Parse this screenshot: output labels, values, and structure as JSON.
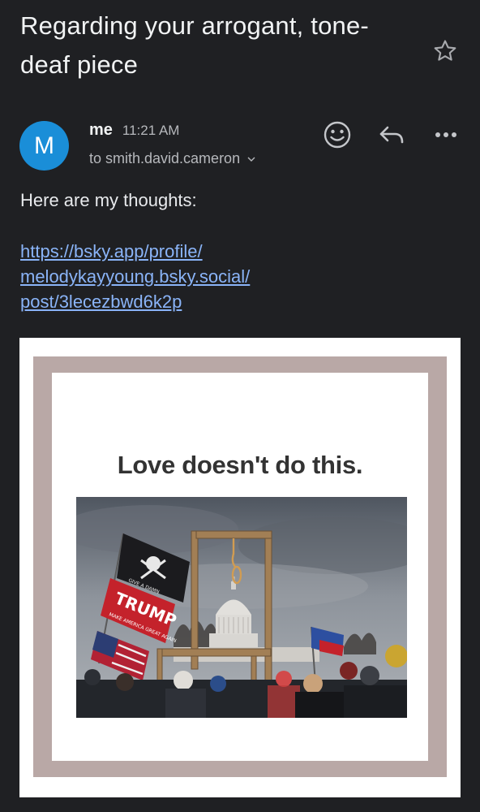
{
  "email": {
    "subject": "Regarding your arrogant, tone-deaf piece",
    "sender": {
      "avatar_letter": "M",
      "name": "me",
      "time": "11:21 AM",
      "recipient": "to smith.david.cameron"
    },
    "body": {
      "intro": "Here are my thoughts:",
      "link_lines": [
        "https://bsky.app/profile/",
        "melodykayyoung.bsky.social/",
        "post/3lecezbwd6k2p"
      ]
    },
    "attachment": {
      "headline": "Love doesn't do this.",
      "flag_pirate_text": "GIVE A DAMN",
      "flag_trump": "TRUMP",
      "flag_trump_sub": "MAKE AMERICA GREAT AGAIN"
    }
  },
  "icons": {
    "star": "star-outline-icon",
    "emoji": "emoji-react-icon",
    "reply": "reply-icon",
    "more": "more-horizontal-icon",
    "chevron": "chevron-down-icon"
  },
  "colors": {
    "background": "#1f2023",
    "avatar": "#1a8ed8",
    "link": "#8ab4f8",
    "frame": "#b9a8a6"
  }
}
